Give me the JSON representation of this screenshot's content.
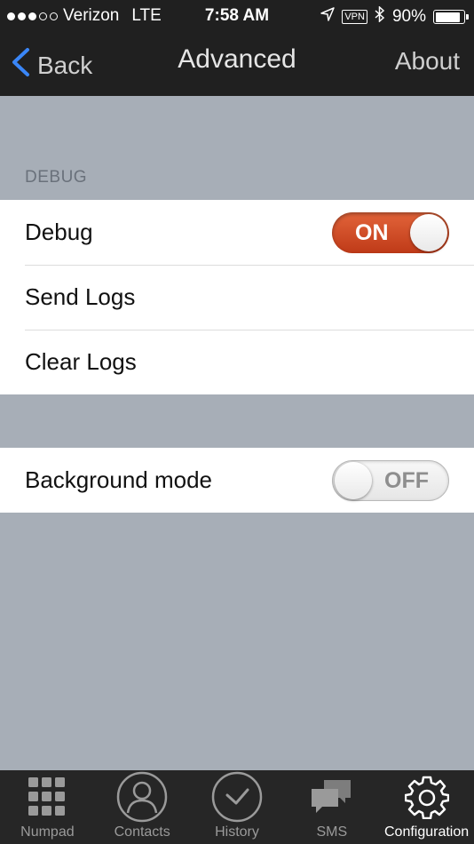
{
  "status": {
    "carrier": "Verizon",
    "network": "LTE",
    "time": "7:58 AM",
    "vpn": "VPN",
    "battery": "90%",
    "battery_level": 0.9
  },
  "nav": {
    "back_label": "Back",
    "title": "Advanced",
    "about_label": "About"
  },
  "debug_section": {
    "header": "DEBUG",
    "debug_label": "Debug",
    "debug_toggle": "ON",
    "send_logs": "Send Logs",
    "clear_logs": "Clear Logs"
  },
  "background_section": {
    "background_label": "Background mode",
    "background_toggle": "OFF"
  },
  "tabs": [
    {
      "label": "Numpad",
      "icon": "numpad-icon"
    },
    {
      "label": "Contacts",
      "icon": "contacts-icon"
    },
    {
      "label": "History",
      "icon": "history-icon"
    },
    {
      "label": "SMS",
      "icon": "sms-icon"
    },
    {
      "label": "Configuration",
      "icon": "gear-icon",
      "active": true
    }
  ],
  "colors": {
    "accent_blue": "#3a86f7",
    "toggle_on": "#d24f28",
    "background": "#a7aeb7"
  }
}
